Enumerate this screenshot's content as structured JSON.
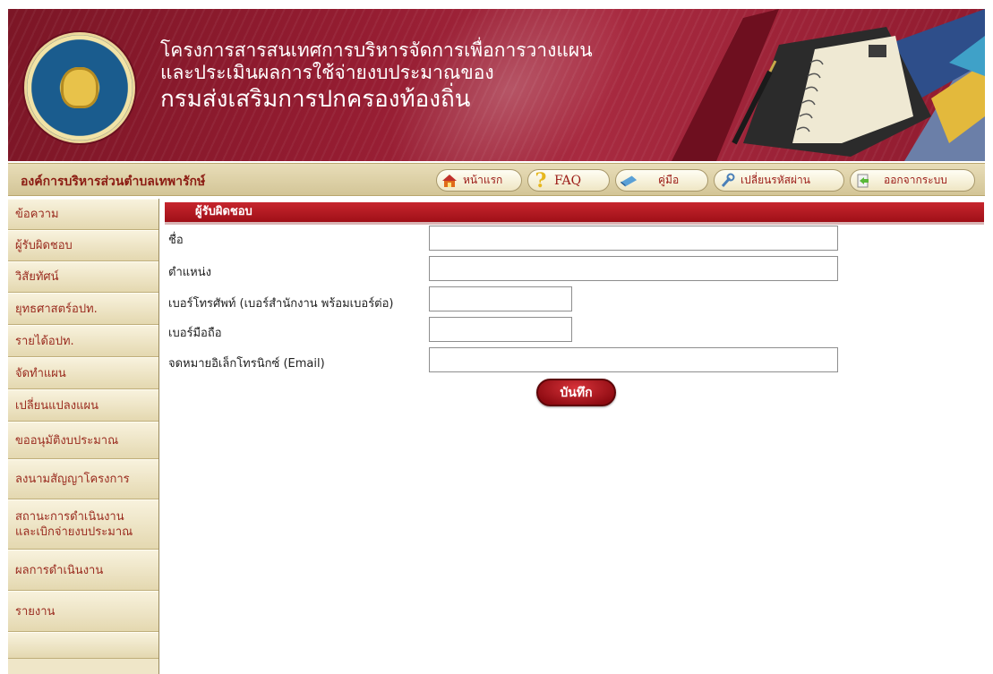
{
  "banner": {
    "title_line1": "โครงการสารสนเทศการบริหารจัดการเพื่อการวางแผน",
    "title_line2": "และประเมินผลการใช้จ่ายงบประมาณของ",
    "title_line3": "กรมส่งเสริมการปกครองท้องถิ่น",
    "seal_icon": "dla-seal-icon",
    "art": "planner-notebook-illustration"
  },
  "navbar": {
    "org_name": "องค์การบริหารส่วนตำบลเทพารักษ์",
    "buttons": [
      {
        "label": "หน้าแรก",
        "icon": "home-icon"
      },
      {
        "label": "FAQ",
        "icon": "question-icon"
      },
      {
        "label": "คู่มือ",
        "icon": "manual-icon"
      },
      {
        "label": "เปลี่ยนรหัสผ่าน",
        "icon": "wrench-icon"
      },
      {
        "label": "ออกจากระบบ",
        "icon": "logout-icon"
      }
    ]
  },
  "sidebar": {
    "items": [
      {
        "label": "ข้อความ"
      },
      {
        "label": "ผู้รับผิดชอบ"
      },
      {
        "label": "วิสัยทัศน์"
      },
      {
        "label": "ยุทธศาสตร์อปท."
      },
      {
        "label": "รายได้อปท."
      },
      {
        "label": "จัดทำแผน"
      },
      {
        "label": "เปลี่ยนแปลงแผน"
      },
      {
        "label": "ขออนุมัติงบประมาณ"
      },
      {
        "label": "ลงนามสัญญาโครงการ"
      },
      {
        "label": "สถานะการดำเนินงาน",
        "label2": "และเบิกจ่ายงบประมาณ"
      },
      {
        "label": "ผลการดำเนินงาน"
      },
      {
        "label": "รายงาน"
      }
    ]
  },
  "form": {
    "section_title": "ผู้รับผิดชอบ",
    "fields": [
      {
        "label": "ชื่อ",
        "value": "",
        "placeholder": ""
      },
      {
        "label": "ตำแหน่ง",
        "value": "",
        "placeholder": ""
      },
      {
        "label": "เบอร์โทรศัพท์ (เบอร์สำนักงาน พร้อมเบอร์ต่อ)",
        "value": "",
        "placeholder": ""
      },
      {
        "label": "เบอร์มือถือ",
        "value": "",
        "placeholder": ""
      },
      {
        "label": "จดหมายอิเล็กโทรนิกซ์ (Email)",
        "value": "",
        "placeholder": ""
      }
    ],
    "save_label": "บันทึก"
  },
  "colors": {
    "banner": "#941c31",
    "nav_text": "#9b1a16",
    "sidebar_text": "#9a2b1f",
    "section_bar": "#b41a22",
    "save_button": "#b01a22"
  }
}
